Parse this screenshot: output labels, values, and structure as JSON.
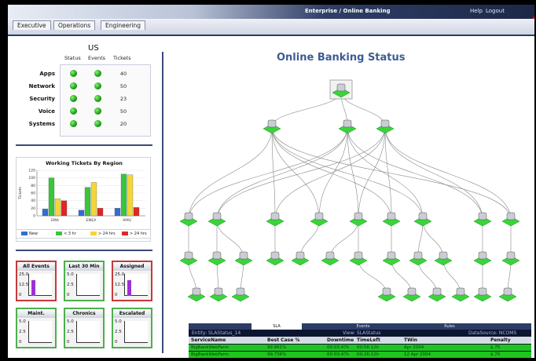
{
  "header": {
    "title": "Enterprise / Online Banking",
    "help": "Help",
    "logout": "Logout"
  },
  "tabs": [
    "Executive",
    "Operations",
    "Engineering"
  ],
  "us_panel": {
    "title": "US",
    "columns": [
      "Status",
      "Events",
      "Tickets"
    ],
    "rows": [
      {
        "label": "Apps",
        "tickets": "40"
      },
      {
        "label": "Network",
        "tickets": "50"
      },
      {
        "label": "Security",
        "tickets": "23"
      },
      {
        "label": "Voice",
        "tickets": "50"
      },
      {
        "label": "Systems",
        "tickets": "20"
      }
    ],
    "status_color": "#21a51a"
  },
  "chart_data": {
    "type": "bar",
    "title": "Working Tickets By Region",
    "ylabel": "Tickets",
    "categories": [
      "EMA",
      "EMEA",
      "APAC"
    ],
    "ylim": [
      0,
      120
    ],
    "yticks": [
      "120",
      "100",
      "80",
      "60",
      "40",
      "20",
      "0"
    ],
    "series": [
      {
        "name": "New",
        "color": "#2f6fd0",
        "values": [
          18,
          15,
          20
        ]
      },
      {
        "name": "< 3 hr",
        "color": "#3cc43c",
        "values": [
          100,
          75,
          110
        ]
      },
      {
        "name": "> 24 hrs",
        "color": "#f5d53a",
        "values": [
          45,
          88,
          108
        ]
      },
      {
        "name": "> 24 hrs",
        "color": "#e02626",
        "values": [
          40,
          20,
          22
        ]
      }
    ]
  },
  "gauges": [
    {
      "title": "All Events",
      "ticks": [
        "25.0",
        "12.5",
        "0"
      ],
      "value": 18,
      "max": 25,
      "border": "#c73a3a"
    },
    {
      "title": "Last 30 Min",
      "ticks": [
        "5.0",
        "2.5",
        "0"
      ],
      "value": 0,
      "max": 5,
      "border": "#4db04d"
    },
    {
      "title": "Assigned",
      "ticks": [
        "25.0",
        "12.5",
        "0"
      ],
      "value": 18,
      "max": 25,
      "border": "#c73a3a"
    },
    {
      "title": "Maint.",
      "ticks": [
        "5.0",
        "2.5",
        "0"
      ],
      "value": 0,
      "max": 5,
      "border": "#4db04d"
    },
    {
      "title": "Chronics",
      "ticks": [
        "5.0",
        "2.5",
        "0"
      ],
      "value": 0,
      "max": 5,
      "border": "#4db04d"
    },
    {
      "title": "Escalated",
      "ticks": [
        "5.0",
        "2.5",
        "0"
      ],
      "value": 0,
      "max": 5,
      "border": "#4db04d"
    }
  ],
  "topology": {
    "title": "Online Banking Status"
  },
  "sla": {
    "tabs": [
      "SLA",
      "Events",
      "Rules"
    ],
    "entity": "Entity: SLAStatus_14",
    "view": "View: SLAStatus",
    "datasource": "DataSource: NCOMS",
    "columns": [
      "ServiceName",
      "Best Case %",
      "Downtime",
      "TimeLeft",
      "TWin",
      "Penalty"
    ],
    "rows": [
      [
        "BigBankWebFarm",
        "99.861%",
        "00:03:47h",
        "00:56:12h",
        "Apr 2004",
        "$.75"
      ],
      [
        "BigBankWebFarm",
        "99.736%",
        "00:03:47h",
        "00:26:12h",
        "12 Apr 2004",
        "$.75"
      ]
    ],
    "row_color": "#1fc41f"
  }
}
